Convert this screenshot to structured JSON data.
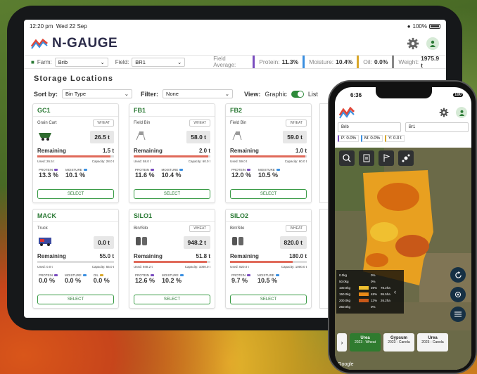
{
  "tablet": {
    "status": {
      "time": "12:20 pm",
      "date": "Wed 22 Sep",
      "battery": "100%"
    },
    "app_name": "N-GAUGE",
    "field_bar": {
      "farm_label": "Farm:",
      "farm_value": "Brib",
      "field_label": "Field:",
      "field_value": "BR1",
      "field_average_label": "Field Average:",
      "protein_label": "Protein:",
      "protein_value": "11.3%",
      "moisture_label": "Moisture:",
      "moisture_value": "10.4%",
      "oil_label": "Oil:",
      "oil_value": "0.0%",
      "weight_label": "Weight:",
      "weight_value": "1975.9 t"
    },
    "title": "Storage Locations",
    "sort_label": "Sort by:",
    "sort_value": "Bin Type",
    "filter_label": "Filter:",
    "filter_value": "None",
    "view_label": "View:",
    "view_graphic": "Graphic",
    "view_list": "List",
    "cards": [
      {
        "name": "GC1",
        "type": "Grain Cart",
        "crop": "WHEAT",
        "amount": "26.5 t",
        "remaining_label": "Remaining",
        "remaining": "1.5 t",
        "used": "Used: 26.5 t",
        "capacity": "Capacity: 28.0 t",
        "fill": 0.95,
        "v1k": "PROTEIN",
        "v1": "13.3 %",
        "v2k": "MOISTURE",
        "v2": "10.1 %",
        "btn": "SELECT"
      },
      {
        "name": "FB1",
        "type": "Field Bin",
        "crop": "WHEAT",
        "amount": "58.0 t",
        "remaining_label": "Remaining",
        "remaining": "2.0 t",
        "used": "Used: 58.0 t",
        "capacity": "Capacity: 60.0 t",
        "fill": 0.97,
        "v1k": "PROTEIN",
        "v1": "11.6 %",
        "v2k": "MOISTURE",
        "v2": "10.4 %",
        "btn": "SELECT"
      },
      {
        "name": "FB2",
        "type": "Field Bin",
        "crop": "WHEAT",
        "amount": "59.0 t",
        "remaining_label": "Remaining",
        "remaining": "1.0 t",
        "used": "Used: 59.0 t",
        "capacity": "Capacity: 60.0 t",
        "fill": 0.98,
        "v1k": "PROTEIN",
        "v1": "12.0 %",
        "v2k": "MOISTURE",
        "v2": "10.5 %",
        "btn": "SELECT"
      },
      {
        "name": "MACK",
        "type": "Truck",
        "crop": "",
        "amount": "0.0 t",
        "remaining_label": "Remaining",
        "remaining": "55.0 t",
        "used": "Used: 0.0 t",
        "capacity": "Capacity: 55.0 t",
        "fill": 0.0,
        "v1k": "PROTEIN",
        "v1": "0.0 %",
        "v2k": "MOISTURE",
        "v2": "0.0 %",
        "v3k": "OIL",
        "v3": "0.0 %",
        "btn": "SELECT"
      },
      {
        "name": "SILO1",
        "type": "Bin/Silo",
        "crop": "WHEAT",
        "amount": "948.2 t",
        "remaining_label": "Remaining",
        "remaining": "51.8 t",
        "used": "Used: 948.2 t",
        "capacity": "Capacity: 1000.0 t",
        "fill": 0.95,
        "v1k": "PROTEIN",
        "v1": "12.6 %",
        "v2k": "MOISTURE",
        "v2": "10.2 %",
        "btn": "SELECT"
      },
      {
        "name": "SILO2",
        "type": "Bin/Silo",
        "crop": "WHEAT",
        "amount": "820.0 t",
        "remaining_label": "Remaining",
        "remaining": "180.0 t",
        "used": "Used: 820.0 t",
        "capacity": "Capacity: 1000.0 t",
        "fill": 0.82,
        "v1k": "PROTEIN",
        "v1": "9.7 %",
        "v2k": "MOISTURE",
        "v2": "10.5 %",
        "btn": "SELECT"
      }
    ]
  },
  "phone": {
    "time": "6:36",
    "battery": "100",
    "farm": "Brib",
    "field": "Br1",
    "p": "P: 0.0%",
    "m": "M: 0.0%",
    "y": "Y: 0.0 t",
    "legend": [
      {
        "rate": "0.0kg",
        "pct": "0%",
        "area": ""
      },
      {
        "rate": "50.0kg",
        "pct": "0%",
        "area": ""
      },
      {
        "rate": "100.0kg",
        "pct": "39%",
        "area": "78.2ha"
      },
      {
        "rate": "150.0kg",
        "pct": "48%",
        "area": "95.5ha"
      },
      {
        "rate": "200.0kg",
        "pct": "13%",
        "area": "26.2ha"
      },
      {
        "rate": "250.0kg",
        "pct": "0%",
        "area": ""
      }
    ],
    "chips": [
      {
        "name": "Urea",
        "sub": "2023 - Wheat"
      },
      {
        "name": "Gypsum",
        "sub": "2023 - Canola"
      },
      {
        "name": "Urea",
        "sub": "2023 - Canola"
      }
    ],
    "google": "Google"
  },
  "colors": {
    "accent": "#2b7a35",
    "protein": "#7a4dbf",
    "moisture": "#3a8fe0",
    "oil": "#d9a72a"
  }
}
